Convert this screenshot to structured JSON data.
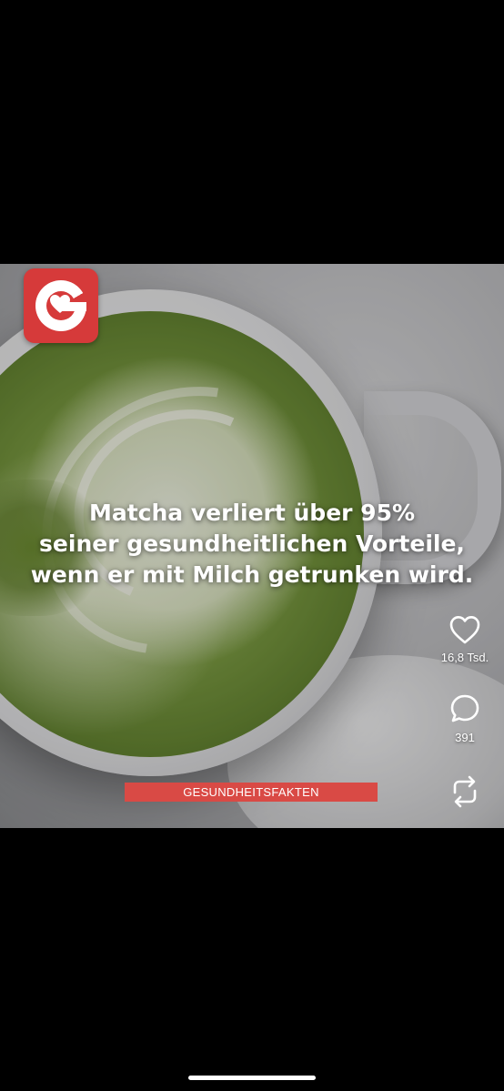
{
  "post": {
    "headline_lines": [
      "Matcha verliert über 95%",
      "seiner gesundheitlichen Vorteile,",
      "wenn er mit Milch getrunken wird."
    ],
    "category_badge": "GESUNDHEITSFAKTEN",
    "brand_color": "#d63a3a"
  },
  "actions": {
    "like": {
      "icon": "heart-icon",
      "count": "16,8 Tsd."
    },
    "comment": {
      "icon": "comment-icon",
      "count": "391"
    },
    "repost": {
      "icon": "repost-icon"
    }
  }
}
